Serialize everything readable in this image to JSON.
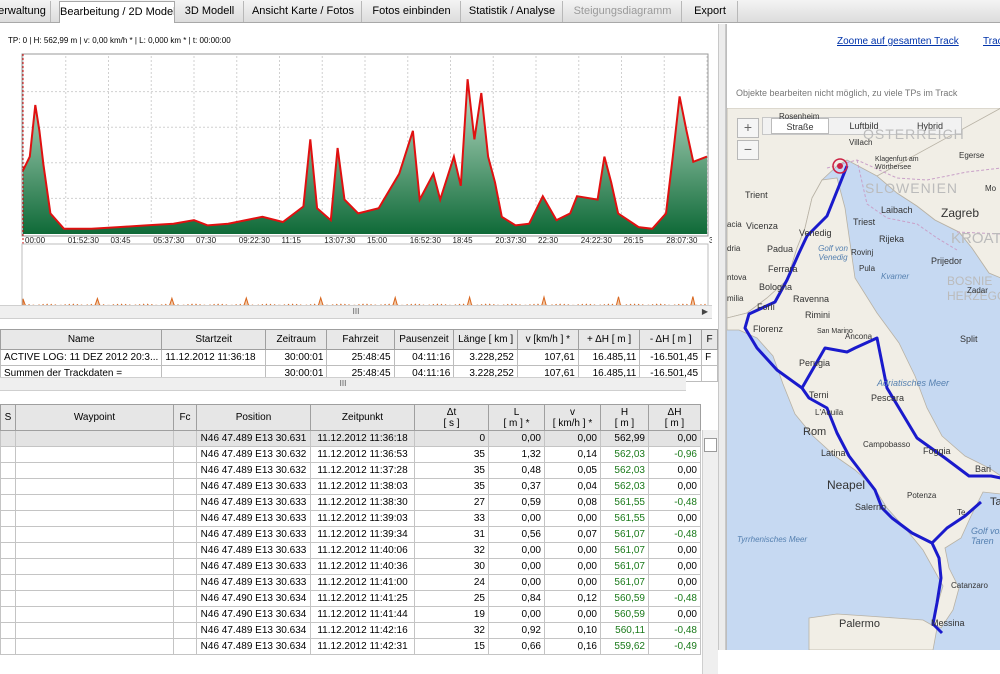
{
  "tabs": [
    {
      "label": "erwaltung",
      "active": false,
      "disabled": false
    },
    {
      "label": "Bearbeitung / 2D Modell",
      "active": true,
      "disabled": false
    },
    {
      "label": "3D Modell",
      "active": false,
      "disabled": false
    },
    {
      "label": "Ansicht Karte / Fotos",
      "active": false,
      "disabled": false
    },
    {
      "label": "Fotos einbinden",
      "active": false,
      "disabled": false
    },
    {
      "label": "Statistik / Analyse",
      "active": false,
      "disabled": false
    },
    {
      "label": "Steigungsdiagramm",
      "active": false,
      "disabled": true
    },
    {
      "label": "Export",
      "active": false,
      "disabled": false
    }
  ],
  "chart": {
    "status": "TP: 0 | H: 562,99 m | v: 0,00 km/h * | L: 0,000 km * | t: 00:00:00",
    "x_ticks": [
      "00:00",
      "01:52:30",
      "03:45",
      "05:37:30",
      "07:30",
      "09:22:30",
      "11:15",
      "13:07:30",
      "15:00",
      "16:52:30",
      "18:45",
      "20:37:30",
      "22:30",
      "24:22:30",
      "26:15",
      "28:07:30",
      "30:00"
    ],
    "colors": {
      "profile": "#e01010",
      "fill_top": "#2c8a4f",
      "speed": "#d8661e",
      "cursor": "#cc0000"
    }
  },
  "summary": {
    "headers": [
      "Name",
      "Startzeit",
      "Zeitraum",
      "Fahrzeit",
      "Pausenzeit",
      "Länge  [ km ]",
      "v  [km/h ] *",
      "+ ΔH  [ m ]",
      "- ΔH  [ m ]",
      "F"
    ],
    "rows": [
      [
        "ACTIVE LOG: 11 DEZ 2012 20:3...",
        "11.12.2012 11:36:18",
        "30:00:01",
        "25:48:45",
        "04:11:16",
        "3.228,252",
        "107,61",
        "16.485,11",
        "-16.501,45",
        "F"
      ],
      [
        "Summen der Trackdaten =",
        "",
        "30:00:01",
        "25:48:45",
        "04:11:16",
        "3.228,252",
        "107,61",
        "16.485,11",
        "-16.501,45",
        ""
      ]
    ]
  },
  "waypoints": {
    "headers": [
      "S",
      "Waypoint",
      "Fc",
      "Position",
      "Zeitpunkt",
      "Δt\n[ s ]",
      "L\n[ m ] *",
      "v\n[ km/h ] *",
      "H\n[ m ]",
      "ΔH\n[ m ]"
    ],
    "rows": [
      [
        "",
        "",
        "",
        "N46 47.489 E13 30.631",
        "11.12.2012 11:36:18",
        "0",
        "0,00",
        "0,00",
        "562,99",
        "0,00"
      ],
      [
        "",
        "",
        "",
        "N46 47.489 E13 30.632",
        "11.12.2012 11:36:53",
        "35",
        "1,32",
        "0,14",
        "562,03",
        "-0,96"
      ],
      [
        "",
        "",
        "",
        "N46 47.489 E13 30.632",
        "11.12.2012 11:37:28",
        "35",
        "0,48",
        "0,05",
        "562,03",
        "0,00"
      ],
      [
        "",
        "",
        "",
        "N46 47.489 E13 30.633",
        "11.12.2012 11:38:03",
        "35",
        "0,37",
        "0,04",
        "562,03",
        "0,00"
      ],
      [
        "",
        "",
        "",
        "N46 47.489 E13 30.633",
        "11.12.2012 11:38:30",
        "27",
        "0,59",
        "0,08",
        "561,55",
        "-0,48"
      ],
      [
        "",
        "",
        "",
        "N46 47.489 E13 30.633",
        "11.12.2012 11:39:03",
        "33",
        "0,00",
        "0,00",
        "561,55",
        "0,00"
      ],
      [
        "",
        "",
        "",
        "N46 47.489 E13 30.633",
        "11.12.2012 11:39:34",
        "31",
        "0,56",
        "0,07",
        "561,07",
        "-0,48"
      ],
      [
        "",
        "",
        "",
        "N46 47.489 E13 30.633",
        "11.12.2012 11:40:06",
        "32",
        "0,00",
        "0,00",
        "561,07",
        "0,00"
      ],
      [
        "",
        "",
        "",
        "N46 47.489 E13 30.633",
        "11.12.2012 11:40:36",
        "30",
        "0,00",
        "0,00",
        "561,07",
        "0,00"
      ],
      [
        "",
        "",
        "",
        "N46 47.489 E13 30.633",
        "11.12.2012 11:41:00",
        "24",
        "0,00",
        "0,00",
        "561,07",
        "0,00"
      ],
      [
        "",
        "",
        "",
        "N46 47.490 E13 30.634",
        "11.12.2012 11:41:25",
        "25",
        "0,84",
        "0,12",
        "560,59",
        "-0,48"
      ],
      [
        "",
        "",
        "",
        "N46 47.490 E13 30.634",
        "11.12.2012 11:41:44",
        "19",
        "0,00",
        "0,00",
        "560,59",
        "0,00"
      ],
      [
        "",
        "",
        "",
        "N46 47.489 E13 30.634",
        "11.12.2012 11:42:16",
        "32",
        "0,92",
        "0,10",
        "560,11",
        "-0,48"
      ],
      [
        "",
        "",
        "",
        "N46 47.489 E13 30.634",
        "11.12.2012 11:42:31",
        "15",
        "0,66",
        "0,16",
        "559,62",
        "-0,49"
      ]
    ]
  },
  "map": {
    "zoom_link": "Zoome auf gesamten Track",
    "second_link": "Trac",
    "note": "Objekte bearbeiten nicht möglich, zu viele TPs im Track",
    "types": [
      "Straße",
      "Luftbild",
      "Hybrid"
    ],
    "active_type": "Straße",
    "zoom_in": "+",
    "zoom_out": "−",
    "route_color": "#1a1acc",
    "cities": [
      "Trient",
      "Vicenza",
      "Venedig",
      "Padua",
      "Ferrara",
      "Bologna",
      "Forlì",
      "Ravenna",
      "Rimini",
      "Florenz",
      "Perugia",
      "Terni",
      "Rom",
      "Latina",
      "Neapel",
      "Salerno",
      "Potenza",
      "Foggia",
      "Pescara",
      "L'Aquila",
      "Campobasso",
      "Ancona",
      "San Marino",
      "Triest",
      "Laibach",
      "Zagreb",
      "Rijeka",
      "Klagenfurt am Wörthersee",
      "Prijedor",
      "Split",
      "Bari",
      "Catanzaro",
      "Palermo",
      "Messina",
      "Villach",
      "Egerse",
      "Ta",
      "Mo",
      "Zadar",
      "Rosenheim"
    ],
    "regions": [
      "ÖSTERREICH",
      "SLOWENIEN",
      "KROAT",
      "BOSNIE HERZEGO"
    ],
    "seas": [
      "Golf von Venedig",
      "Kvarner",
      "Adriatisches Meer",
      "Tyrrhenisches Meer",
      "Golf von Taren"
    ],
    "edge_labels": [
      "acia",
      "ntova",
      "milia",
      "dria",
      "Rovinj",
      "Pula",
      "Te"
    ]
  }
}
